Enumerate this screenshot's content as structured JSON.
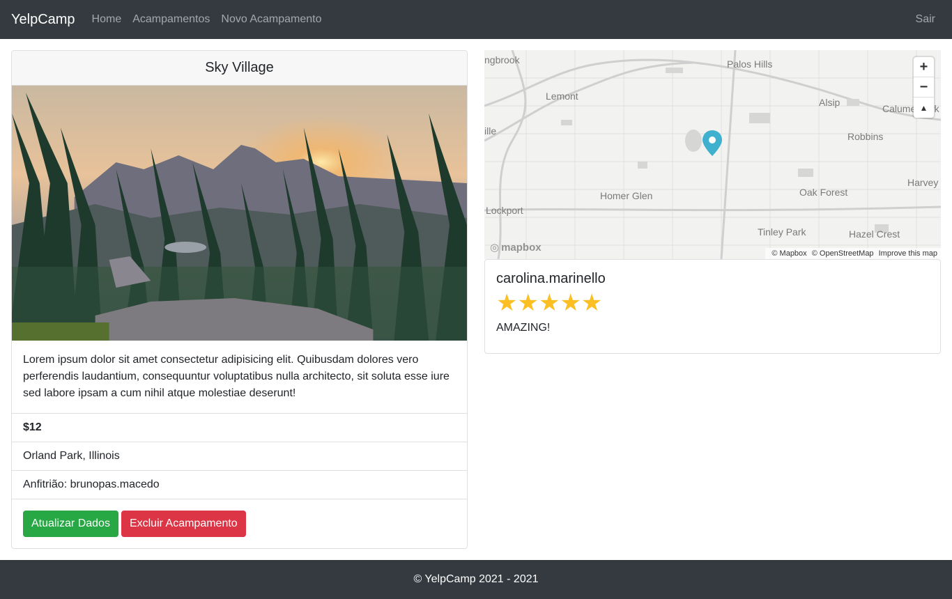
{
  "navbar": {
    "brand": "YelpCamp",
    "links": [
      "Home",
      "Acampamentos",
      "Novo Acampamento"
    ],
    "logout": "Sair"
  },
  "campground": {
    "title": "Sky Village",
    "description": "Lorem ipsum dolor sit amet consectetur adipisicing elit. Quibusdam dolores vero perferendis laudantium, consequuntur voluptatibus nulla architecto, sit soluta esse iure sed labore ipsam a cum nihil atque molestiae deserunt!",
    "price": "$12",
    "location": "Orland Park, Illinois",
    "host": "Anfitrião: brunopas.macedo",
    "update_button": "Atualizar Dados",
    "delete_button": "Excluir Acampamento"
  },
  "map": {
    "labels": {
      "bridgebrook": "ngbrook",
      "palos_hills": "Palos Hills",
      "lemont": "Lemont",
      "alsip": "Alsip",
      "calumet": "Calume",
      "calumet_end": "rk",
      "robbins": "Robbins",
      "ville": "ille",
      "harvey": "Harvey",
      "oak_forest": "Oak Forest",
      "homer_glen": "Homer Glen",
      "lockport": "Lockport",
      "tinley_park": "Tinley Park",
      "hazel_crest": "Hazel Crest"
    },
    "zoom_in": "+",
    "zoom_out": "−",
    "compass": "▲",
    "logo": "mapbox",
    "attribution": [
      "© Mapbox",
      "© OpenStreetMap",
      "Improve this map"
    ],
    "marker_color": "#3fb1ce"
  },
  "review": {
    "author": "carolina.marinello",
    "rating": 5,
    "stars": "★★★★★",
    "text": "AMAZING!"
  },
  "footer": {
    "text": "© YelpCamp 2021 - 2021"
  }
}
